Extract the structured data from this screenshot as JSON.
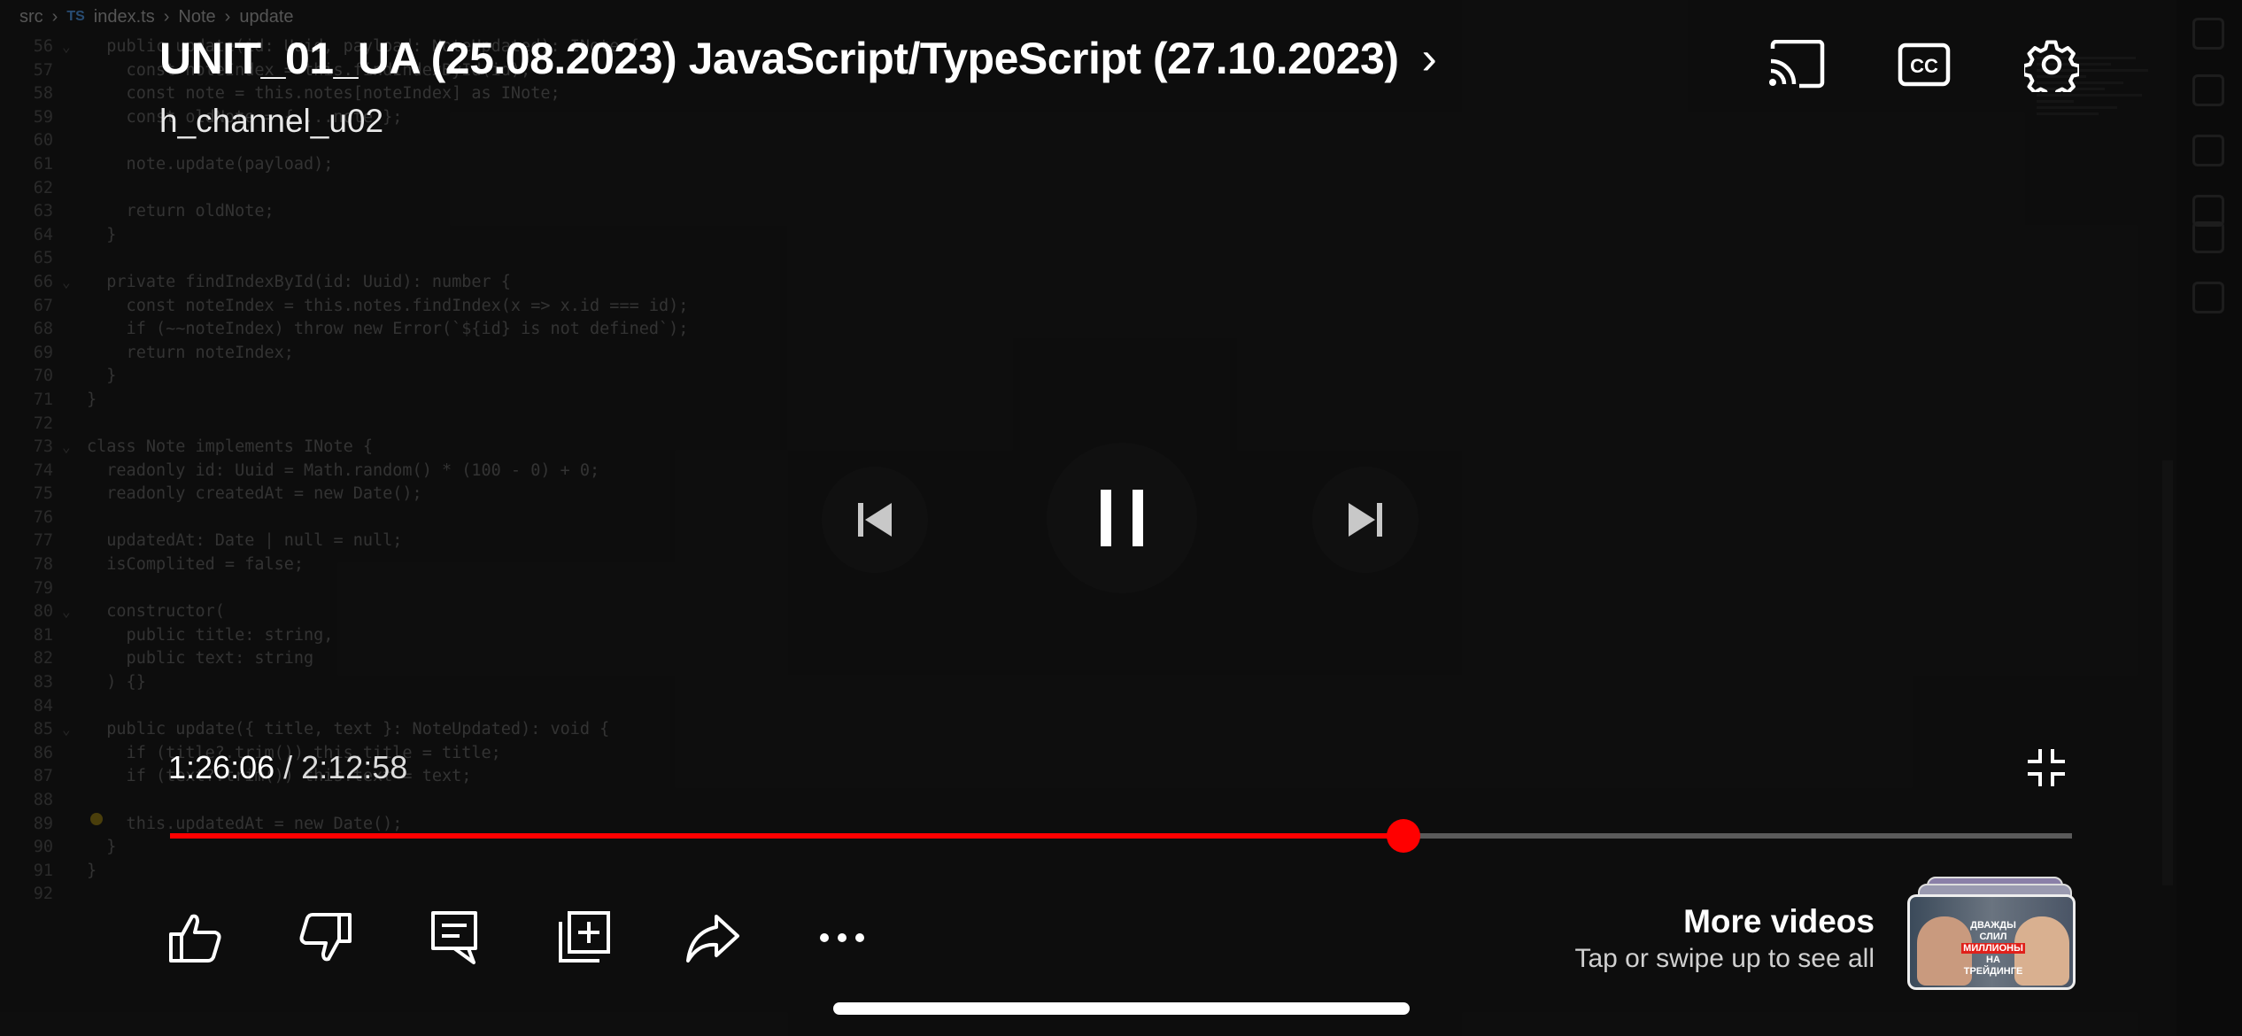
{
  "editor": {
    "breadcrumb": [
      "src",
      "TS",
      "index.ts",
      "Note",
      "update"
    ],
    "lines": [
      {
        "n": "56",
        "fold": true,
        "text": "  public update(id: Uuid, payload: NoteUpdated): INote {"
      },
      {
        "n": "57",
        "fold": false,
        "text": "    const noteIndex = this.findIndexById(id);"
      },
      {
        "n": "58",
        "fold": false,
        "text": "    const note = this.notes[noteIndex] as INote;"
      },
      {
        "n": "59",
        "fold": false,
        "text": "    const oldNote = { ...note };"
      },
      {
        "n": "60",
        "fold": false,
        "text": ""
      },
      {
        "n": "61",
        "fold": false,
        "text": "    note.update(payload);"
      },
      {
        "n": "62",
        "fold": false,
        "text": ""
      },
      {
        "n": "63",
        "fold": false,
        "text": "    return oldNote;"
      },
      {
        "n": "64",
        "fold": false,
        "text": "  }"
      },
      {
        "n": "65",
        "fold": false,
        "text": ""
      },
      {
        "n": "66",
        "fold": true,
        "text": "  private findIndexById(id: Uuid): number {"
      },
      {
        "n": "67",
        "fold": false,
        "text": "    const noteIndex = this.notes.findIndex(x => x.id === id);"
      },
      {
        "n": "68",
        "fold": false,
        "text": "    if (~~noteIndex) throw new Error(`${id} is not defined`);"
      },
      {
        "n": "69",
        "fold": false,
        "text": "    return noteIndex;"
      },
      {
        "n": "70",
        "fold": false,
        "text": "  }"
      },
      {
        "n": "71",
        "fold": false,
        "text": "}"
      },
      {
        "n": "72",
        "fold": false,
        "text": ""
      },
      {
        "n": "73",
        "fold": true,
        "text": "class Note implements INote {"
      },
      {
        "n": "74",
        "fold": false,
        "text": "  readonly id: Uuid = Math.random() * (100 - 0) + 0;"
      },
      {
        "n": "75",
        "fold": false,
        "text": "  readonly createdAt = new Date();"
      },
      {
        "n": "76",
        "fold": false,
        "text": ""
      },
      {
        "n": "77",
        "fold": false,
        "text": "  updatedAt: Date | null = null;"
      },
      {
        "n": "78",
        "fold": false,
        "text": "  isComplited = false;"
      },
      {
        "n": "79",
        "fold": false,
        "text": ""
      },
      {
        "n": "80",
        "fold": true,
        "text": "  constructor("
      },
      {
        "n": "81",
        "fold": false,
        "text": "    public title: string,"
      },
      {
        "n": "82",
        "fold": false,
        "text": "    public text: string"
      },
      {
        "n": "83",
        "fold": false,
        "text": "  ) {}"
      },
      {
        "n": "84",
        "fold": false,
        "text": ""
      },
      {
        "n": "85",
        "fold": true,
        "text": "  public update({ title, text }: NoteUpdated): void {"
      },
      {
        "n": "86",
        "fold": false,
        "text": "    if (title?.trim()) this.title = title;"
      },
      {
        "n": "87",
        "fold": false,
        "text": "    if (text?.trim()) this.text = text;"
      },
      {
        "n": "88",
        "fold": false,
        "text": ""
      },
      {
        "n": "89",
        "fold": false,
        "text": "    this.updatedAt = new Date();"
      },
      {
        "n": "90",
        "fold": false,
        "text": "  }"
      },
      {
        "n": "91",
        "fold": false,
        "text": "}"
      },
      {
        "n": "92",
        "fold": false,
        "text": ""
      }
    ]
  },
  "player": {
    "title": "UNIT_01_UA (25.08.2023) JavaScript/TypeScript (27.10.2023)",
    "channel": "h_channel_u02",
    "time_current": "1:26:06",
    "time_separator": "/",
    "time_total": "2:12:58",
    "progress": 0.6485,
    "icons": {
      "cast": "cast-icon",
      "captions": "captions-icon",
      "settings": "gear-icon",
      "previous": "previous-icon",
      "pause": "pause-icon",
      "next": "next-icon",
      "exit_fullscreen": "exit-fullscreen-icon"
    },
    "accent_color": "#ff0000"
  },
  "actions": [
    {
      "name": "like-button",
      "icon": "thumbs-up-icon"
    },
    {
      "name": "dislike-button",
      "icon": "thumbs-down-icon"
    },
    {
      "name": "comments-button",
      "icon": "comment-icon"
    },
    {
      "name": "save-button",
      "icon": "add-to-playlist-icon"
    },
    {
      "name": "share-button",
      "icon": "share-icon"
    },
    {
      "name": "more-button",
      "icon": "more-icon"
    }
  ],
  "more_videos": {
    "title": "More videos",
    "subtitle": "Tap or swipe up to see all",
    "thumbnail_caption_1": "ДВАЖДЫ СЛИЛ",
    "thumbnail_caption_2": "МИЛЛИОНЫ",
    "thumbnail_caption_3": "НА ТРЕЙДИНГЕ"
  }
}
